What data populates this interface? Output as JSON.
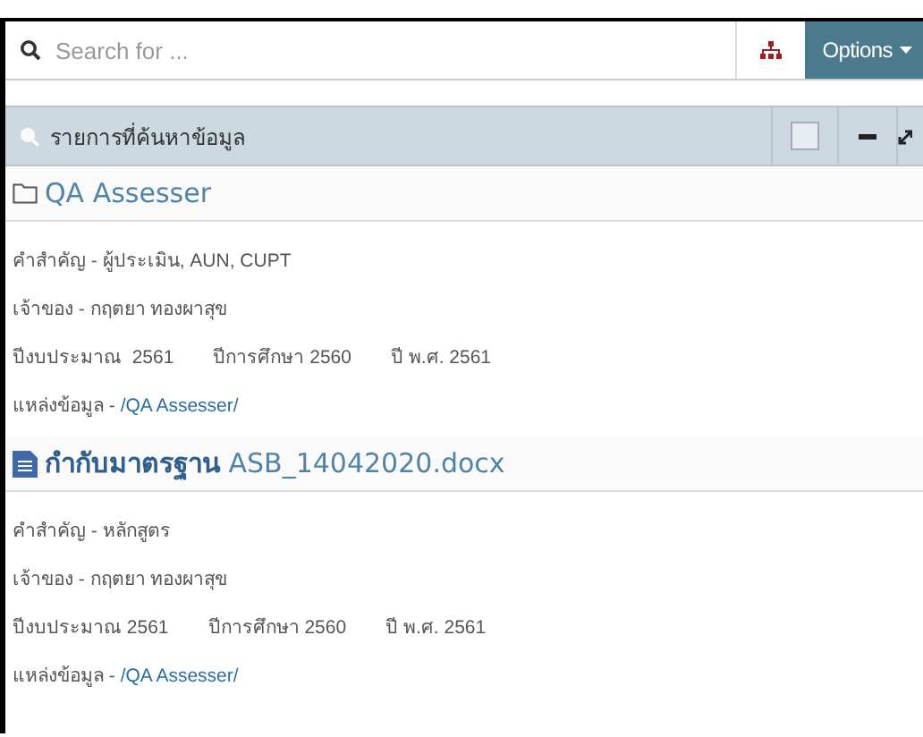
{
  "search": {
    "placeholder": "Search for ..."
  },
  "options_button": "Options",
  "panel": {
    "title": "รายการที่ค้นหาข้อมูล",
    "checked": false
  },
  "results": [
    {
      "kind": "folder",
      "title": "QA Assesser",
      "keywords": "คำสำคัญ - ผู้ประเมิน, AUN, CUPT",
      "owner": "เจ้าของ - กฤตยา  ทองผาสุข",
      "years": [
        "ปีงบประมาณ  2561",
        "ปีการศึกษา 2560",
        "ปี พ.ศ. 2561"
      ],
      "source_label": "แหล่งข้อมูล - ",
      "source_link": "/QA Assesser/"
    },
    {
      "kind": "document",
      "title": "**กำกับมาตรฐาน** ASB_14042020.docx",
      "keywords": "คำสำคัญ - หลักสูตร",
      "owner": "เจ้าของ - กฤตยา  ทองผาสุข",
      "years": [
        "ปีงบประมาณ 2561",
        "ปีการศึกษา 2560",
        "ปี พ.ศ. 2561"
      ],
      "source_label": "แหล่งข้อมูล - ",
      "source_link": "/QA Assesser/"
    }
  ]
}
